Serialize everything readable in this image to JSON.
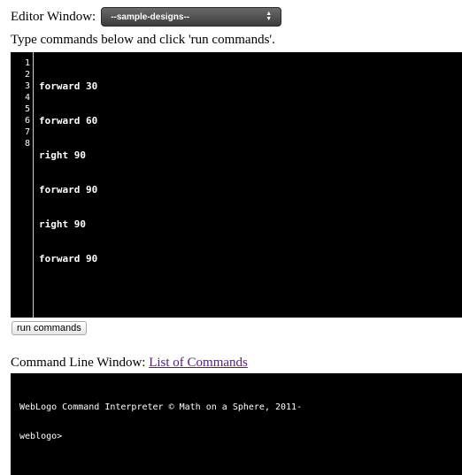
{
  "editor_header": {
    "label": "Editor Window:",
    "dropdown_selected": "--sample-designs--"
  },
  "instructions": "Type commands below and click 'run commands'.",
  "editor": {
    "line_numbers": [
      "1",
      "2",
      "3",
      "4",
      "5",
      "6",
      "7",
      "8"
    ],
    "lines": [
      "forward 30",
      "forward 60",
      "right 90",
      "forward 90",
      "right 90",
      "forward 90",
      "",
      ""
    ]
  },
  "run_button_label": "run commands",
  "command_line": {
    "label": "Command Line Window:",
    "link_text": "List of Commands"
  },
  "terminal": {
    "banner": "WebLogo Command Interpreter © Math on a Sphere, 2011-",
    "prompt": "weblogo>"
  },
  "colors": {
    "editor_bg": "#000000",
    "link": "#551a8b"
  }
}
